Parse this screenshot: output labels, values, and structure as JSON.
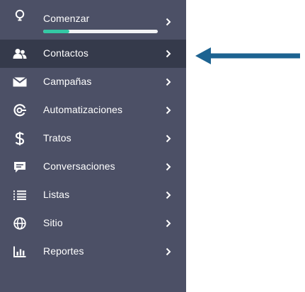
{
  "colors": {
    "sidebar_bg": "#4c5066",
    "active_bg": "#353a4b",
    "progress_fill": "#33c9a4",
    "progress_track": "#f2f3f5",
    "annotation_arrow": "#1d6391",
    "text": "#ffffff"
  },
  "sidebar": {
    "items": [
      {
        "label": "Comenzar",
        "icon": "lightbulb-icon",
        "progress": 0.23
      },
      {
        "label": "Contactos",
        "icon": "contacts-icon",
        "active": true
      },
      {
        "label": "Campañas",
        "icon": "envelope-icon"
      },
      {
        "label": "Automatizaciones",
        "icon": "automation-icon"
      },
      {
        "label": "Tratos",
        "icon": "dollar-icon"
      },
      {
        "label": "Conversaciones",
        "icon": "chat-icon"
      },
      {
        "label": "Listas",
        "icon": "list-icon"
      },
      {
        "label": "Sitio",
        "icon": "globe-icon"
      },
      {
        "label": "Reportes",
        "icon": "bar-chart-icon"
      }
    ]
  },
  "annotation": {
    "icon": "left-arrow-icon"
  }
}
